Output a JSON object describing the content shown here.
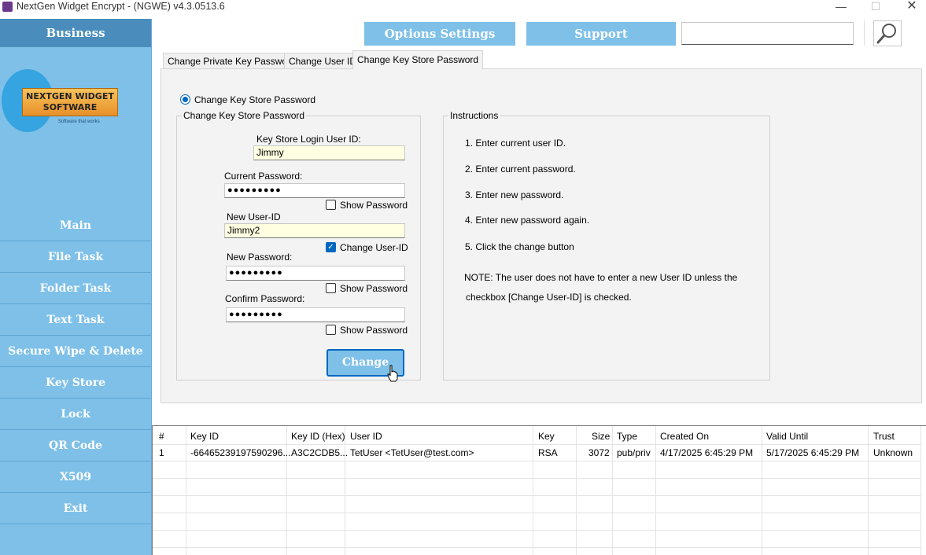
{
  "window": {
    "title": "NextGen Widget Encrypt - (NGWE) v4.3.0513.6",
    "minimize": "—",
    "maximize": "☐",
    "close": "✕"
  },
  "sidebar": {
    "header": "Business",
    "logo_line1": "NEXTGEN WIDGET",
    "logo_line2": "SOFTWARE",
    "logo_tagline": "Software that works",
    "items": [
      "Main",
      "File Task",
      "Folder Task",
      "Text Task",
      "Secure Wipe & Delete",
      "Key Store",
      "Lock",
      "QR Code",
      "X509",
      "Exit"
    ]
  },
  "topbar": {
    "options_label": "Options Settings",
    "support_label": "Support",
    "search_value": ""
  },
  "tabs": [
    "Change Private Key Password",
    "Change User ID",
    "Change Key Store Password"
  ],
  "form": {
    "radio_label": "Change Key Store Password",
    "group_title": "Change Key Store Password",
    "login_label": "Key Store Login User ID:",
    "login_value": "Jimmy",
    "current_pw_label": "Current Password:",
    "current_pw_value": "●●●●●●●●●",
    "show_password_1": "Show Password",
    "new_userid_label": "New User-ID",
    "new_userid_value": "Jimmy2",
    "change_userid_label": "Change User-ID",
    "change_userid_checked": "✓",
    "new_pw_label": "New Password:",
    "new_pw_value": "●●●●●●●●●",
    "show_password_2": "Show Password",
    "confirm_pw_label": "Confirm Password:",
    "confirm_pw_value": "●●●●●●●●●",
    "show_password_3": "Show Password",
    "change_button": "Change"
  },
  "instructions": {
    "title": "Instructions",
    "lines": [
      "1. Enter current user ID.",
      "2. Enter current password.",
      "3. Enter new password.",
      "4. Enter new password again.",
      "5. Click the change button",
      "NOTE: The user does not have to enter a new User ID unless the",
      "checkbox [Change User-ID] is checked."
    ]
  },
  "grid": {
    "headers": [
      "#",
      "Key ID",
      "Key ID (Hex)",
      "User ID",
      "Key",
      "Size",
      "Type",
      "Created On",
      "Valid Until",
      "Trust"
    ],
    "rows": [
      [
        "1",
        "-66465239197590296...",
        "A3C2CDB5...",
        "TetUser <TetUser@test.com>",
        "RSA",
        "3072",
        "pub/priv",
        "4/17/2025 6:45:29 PM",
        "5/17/2025 6:45:29 PM",
        "Unknown"
      ]
    ]
  },
  "colors": {
    "sidebar": "#7ec0e8",
    "sidebar_header": "#4a8dbd",
    "accent": "#0067c0",
    "input_highlight": "#ffffe1"
  }
}
